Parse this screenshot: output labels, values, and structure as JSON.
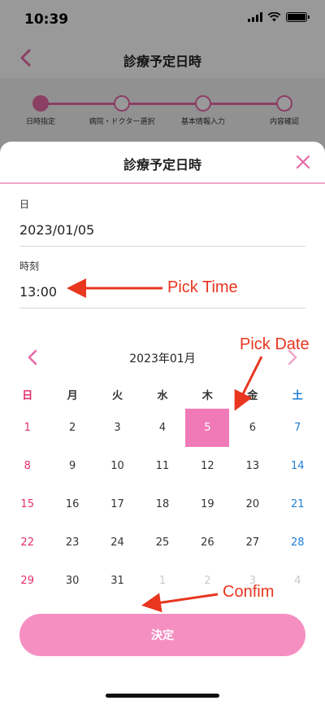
{
  "status_bar": {
    "time": "10:39"
  },
  "background_page": {
    "title": "診療予定日時",
    "steps": [
      {
        "label": "日時指定",
        "active": true
      },
      {
        "label": "病院・ドクター選択",
        "active": false
      },
      {
        "label": "基本情報入力",
        "active": false
      },
      {
        "label": "内容確認",
        "active": false
      }
    ]
  },
  "sheet": {
    "title": "診療予定日時",
    "date_field": {
      "label": "日",
      "value": "2023/01/05"
    },
    "time_field": {
      "label": "時刻",
      "value": "13:00"
    },
    "calendar": {
      "month_label": "2023年01月",
      "weekdays": [
        "日",
        "月",
        "火",
        "水",
        "木",
        "金",
        "土"
      ],
      "weeks": [
        [
          {
            "day": "1",
            "muted": false,
            "selected": false
          },
          {
            "day": "2",
            "muted": false,
            "selected": false
          },
          {
            "day": "3",
            "muted": false,
            "selected": false
          },
          {
            "day": "4",
            "muted": false,
            "selected": false
          },
          {
            "day": "5",
            "muted": false,
            "selected": true
          },
          {
            "day": "6",
            "muted": false,
            "selected": false
          },
          {
            "day": "7",
            "muted": false,
            "selected": false
          }
        ],
        [
          {
            "day": "8",
            "muted": false,
            "selected": false
          },
          {
            "day": "9",
            "muted": false,
            "selected": false
          },
          {
            "day": "10",
            "muted": false,
            "selected": false
          },
          {
            "day": "11",
            "muted": false,
            "selected": false
          },
          {
            "day": "12",
            "muted": false,
            "selected": false
          },
          {
            "day": "13",
            "muted": false,
            "selected": false
          },
          {
            "day": "14",
            "muted": false,
            "selected": false
          }
        ],
        [
          {
            "day": "15",
            "muted": false,
            "selected": false
          },
          {
            "day": "16",
            "muted": false,
            "selected": false
          },
          {
            "day": "17",
            "muted": false,
            "selected": false
          },
          {
            "day": "18",
            "muted": false,
            "selected": false
          },
          {
            "day": "19",
            "muted": false,
            "selected": false
          },
          {
            "day": "20",
            "muted": false,
            "selected": false
          },
          {
            "day": "21",
            "muted": false,
            "selected": false
          }
        ],
        [
          {
            "day": "22",
            "muted": false,
            "selected": false
          },
          {
            "day": "23",
            "muted": false,
            "selected": false
          },
          {
            "day": "24",
            "muted": false,
            "selected": false
          },
          {
            "day": "25",
            "muted": false,
            "selected": false
          },
          {
            "day": "26",
            "muted": false,
            "selected": false
          },
          {
            "day": "27",
            "muted": false,
            "selected": false
          },
          {
            "day": "28",
            "muted": false,
            "selected": false
          }
        ],
        [
          {
            "day": "29",
            "muted": false,
            "selected": false
          },
          {
            "day": "30",
            "muted": false,
            "selected": false
          },
          {
            "day": "31",
            "muted": false,
            "selected": false
          },
          {
            "day": "1",
            "muted": true,
            "selected": false
          },
          {
            "day": "2",
            "muted": true,
            "selected": false
          },
          {
            "day": "3",
            "muted": true,
            "selected": false
          },
          {
            "day": "4",
            "muted": true,
            "selected": false
          }
        ]
      ]
    },
    "confirm_label": "決定"
  },
  "annotations": {
    "pick_time": "Pick Time",
    "pick_date": "Pick Date",
    "confirm": "Confim"
  },
  "colors": {
    "accent_pink": "#e86aa6",
    "selected_day": "#f07ab8",
    "button_pink": "#f58fc2",
    "sunday_red": "#e0306a",
    "saturday_blue": "#1f7fd4",
    "annotation_red": "#e8361f"
  },
  "icons": {
    "back": "chevron-left-icon",
    "close": "close-icon",
    "prev_month": "chevron-left-icon",
    "next_month": "chevron-right-icon"
  }
}
